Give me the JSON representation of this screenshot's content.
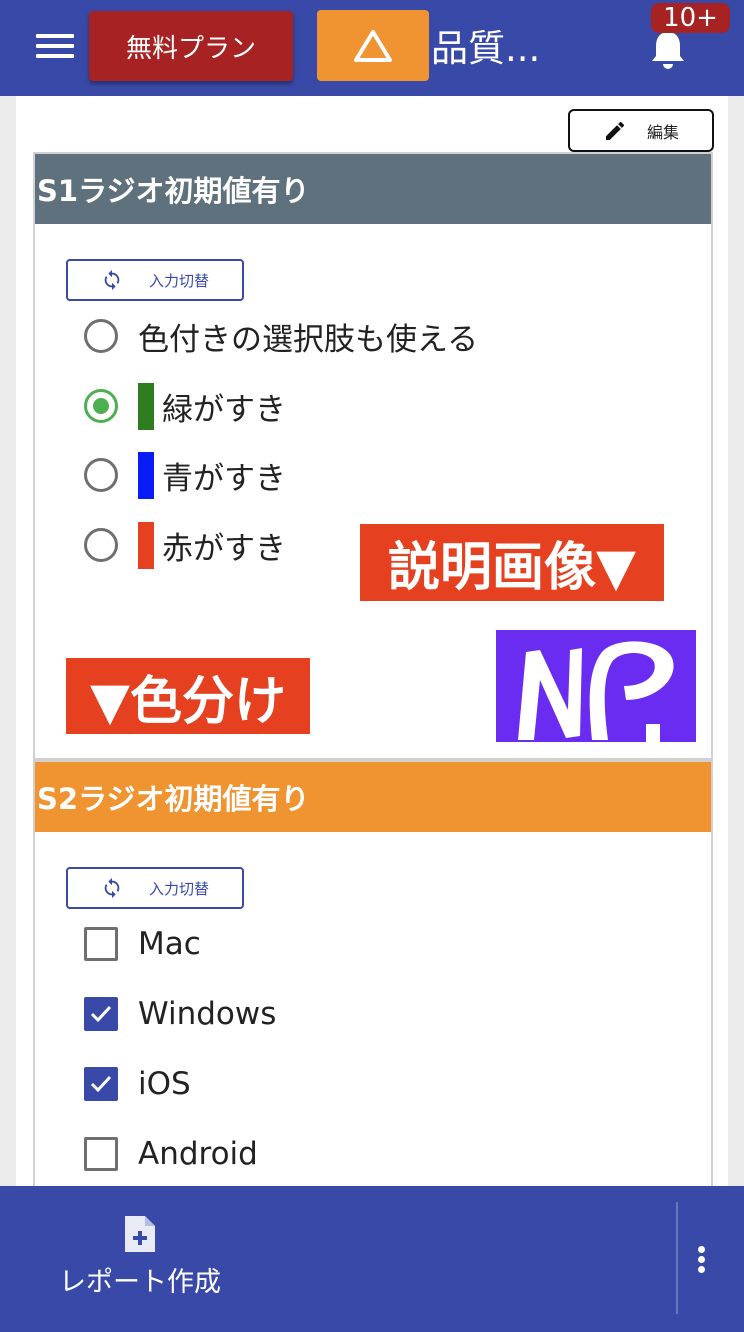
{
  "header": {
    "plan_label": "無料プラン",
    "title": "品質...",
    "notification_count": "10+"
  },
  "toolbar": {
    "edit_label": "編集"
  },
  "section1": {
    "title": "S1ラジオ初期値有り",
    "toggle_label": "入力切替",
    "options": [
      {
        "label": "色付きの選択肢も使える",
        "selected": false,
        "color": null
      },
      {
        "label": "緑がすき",
        "selected": true,
        "color": "#2e7d1f"
      },
      {
        "label": "青がすき",
        "selected": false,
        "color": "#0a1cf5"
      },
      {
        "label": "赤がすき",
        "selected": false,
        "color": "#e5401f"
      }
    ],
    "explain_label": "説明画像▼",
    "color_split_label": "▼色分け"
  },
  "section2": {
    "title": "S2ラジオ初期値有り",
    "toggle_label": "入力切替",
    "options": [
      {
        "label": "Mac",
        "checked": false
      },
      {
        "label": "Windows",
        "checked": true
      },
      {
        "label": "iOS",
        "checked": true
      },
      {
        "label": "Android",
        "checked": false
      }
    ]
  },
  "bottom": {
    "report_label": "レポート作成"
  },
  "colors": {
    "primary": "#3949a8",
    "header_gray": "#5f717c",
    "accent_orange": "#ef9431",
    "plan_red": "#a72222",
    "radio_green": "#4caf50",
    "label_red": "#e5401f",
    "logo_purple": "#6a2cf0"
  }
}
